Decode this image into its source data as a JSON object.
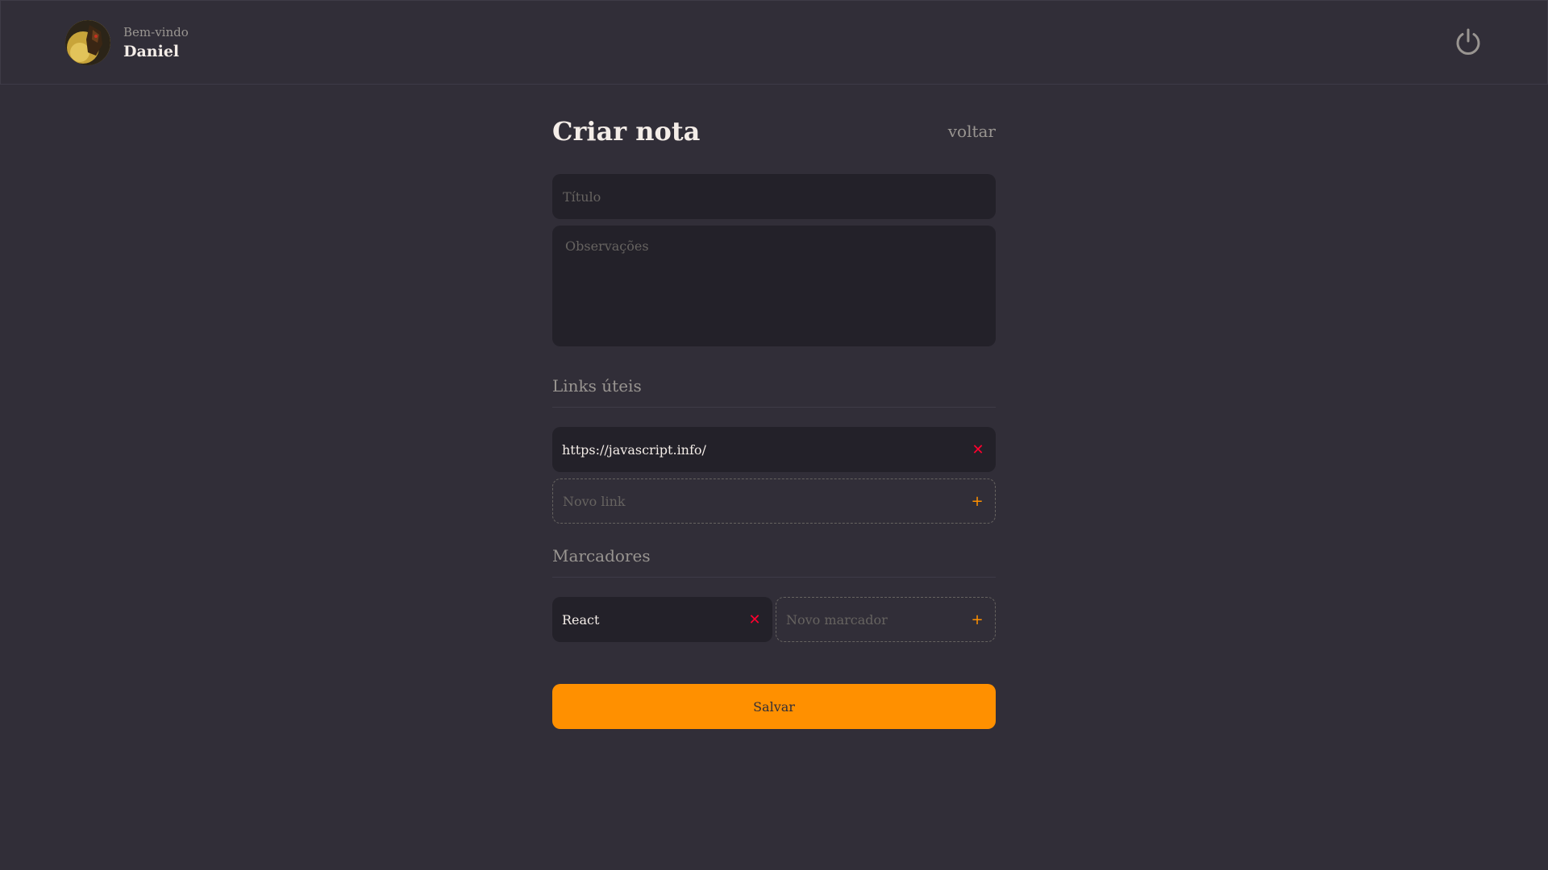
{
  "header": {
    "welcome": "Bem-vindo",
    "username": "Daniel",
    "avatar_icon": "avatar-image",
    "logout_icon": "power-icon"
  },
  "page": {
    "title": "Criar nota",
    "back_label": "voltar"
  },
  "form": {
    "title_placeholder": "Título",
    "notes_placeholder": "Observações",
    "links_section": "Links úteis",
    "links": [
      "https://javascript.info/"
    ],
    "new_link_placeholder": "Novo link",
    "tags_section": "Marcadores",
    "tags": [
      "React"
    ],
    "new_tag_placeholder": "Novo marcador",
    "save_label": "Salvar"
  },
  "colors": {
    "background": "#312e38",
    "input_bg": "#232129",
    "accent": "#ff9000",
    "remove": "#ff002e",
    "muted": "#999591"
  }
}
